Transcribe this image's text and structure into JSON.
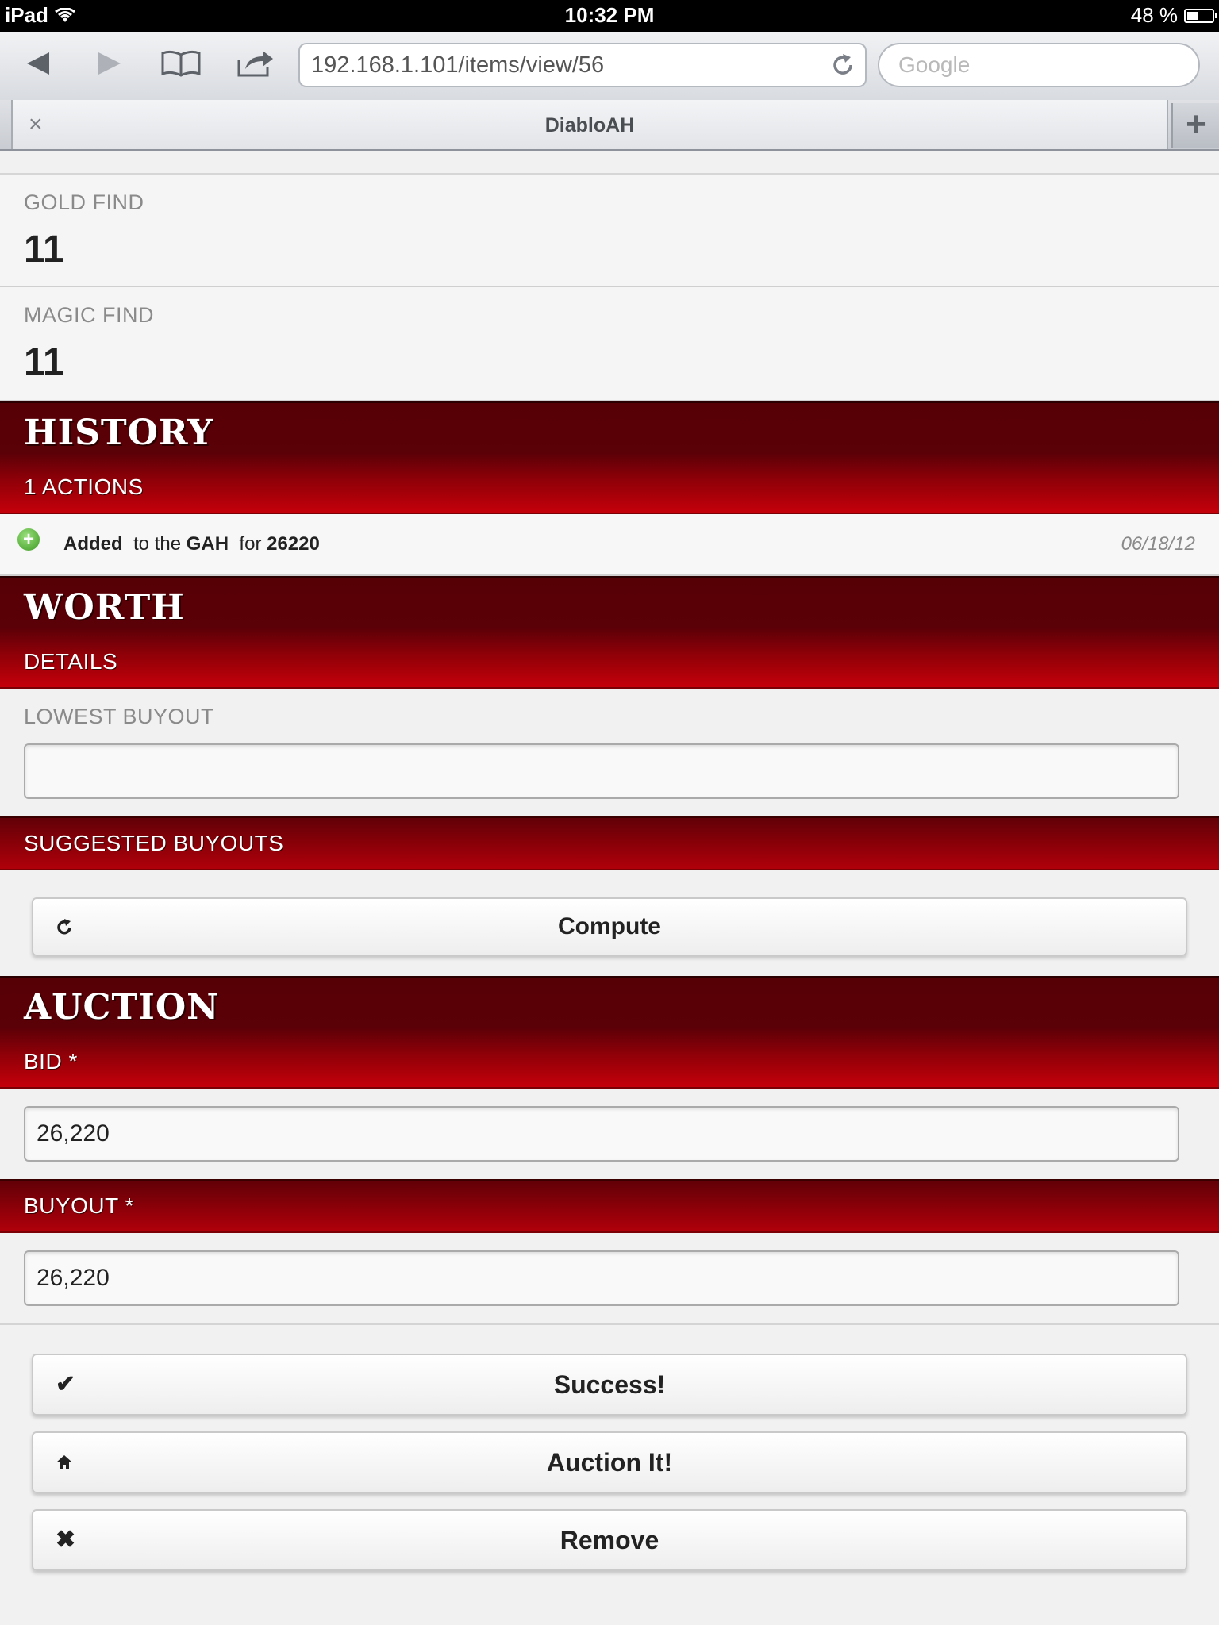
{
  "status_bar": {
    "device": "iPad",
    "time": "10:32 PM",
    "battery": "48 %",
    "battery_level": 0.48
  },
  "browser": {
    "url": "192.168.1.101/items/view/56",
    "search_placeholder": "Google",
    "tab_title": "DiabloAH",
    "tab_close": "×",
    "new_tab": "+"
  },
  "stats": [
    {
      "label": "GOLD FIND",
      "value": "11"
    },
    {
      "label": "MAGIC FIND",
      "value": "11"
    }
  ],
  "history": {
    "title": "HISTORY",
    "subtitle": "1 ACTIONS",
    "entry": {
      "action": "Added",
      "mid": "to the",
      "house": "GAH",
      "for": "for",
      "amount": "26220",
      "date": "06/18/12"
    }
  },
  "worth": {
    "title": "WORTH",
    "subtitle": "DETAILS",
    "lowest_buyout_label": "LOWEST BUYOUT",
    "lowest_buyout_value": "",
    "suggested_label": "SUGGESTED BUYOUTS",
    "compute_label": "Compute"
  },
  "auction": {
    "title": "AUCTION",
    "bid_label": "BID *",
    "bid_value": "26,220",
    "buyout_label": "BUYOUT *",
    "buyout_value": "26,220"
  },
  "actions": {
    "success_label": "Success!",
    "auction_label": "Auction It!",
    "remove_label": "Remove"
  }
}
